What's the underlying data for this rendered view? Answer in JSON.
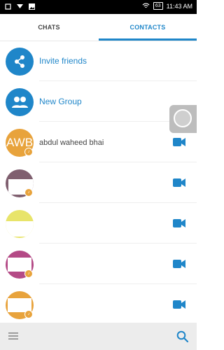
{
  "statusbar": {
    "battery": "63",
    "time": "11:43 AM"
  },
  "tabs": {
    "chats": "CHATS",
    "contacts": "CONTACTS"
  },
  "actions": {
    "invite": "Invite friends",
    "new_group": "New Group"
  },
  "contacts": [
    {
      "avatar_text": "AWB",
      "name": "abdul waheed bhai"
    }
  ],
  "colors": {
    "accent": "#1f86c9",
    "avatar_orange": "#e8a33c"
  },
  "icons": {
    "share": "share-icon",
    "group": "group-icon",
    "video": "video-call-icon",
    "menu": "menu-icon",
    "search": "search-icon"
  }
}
